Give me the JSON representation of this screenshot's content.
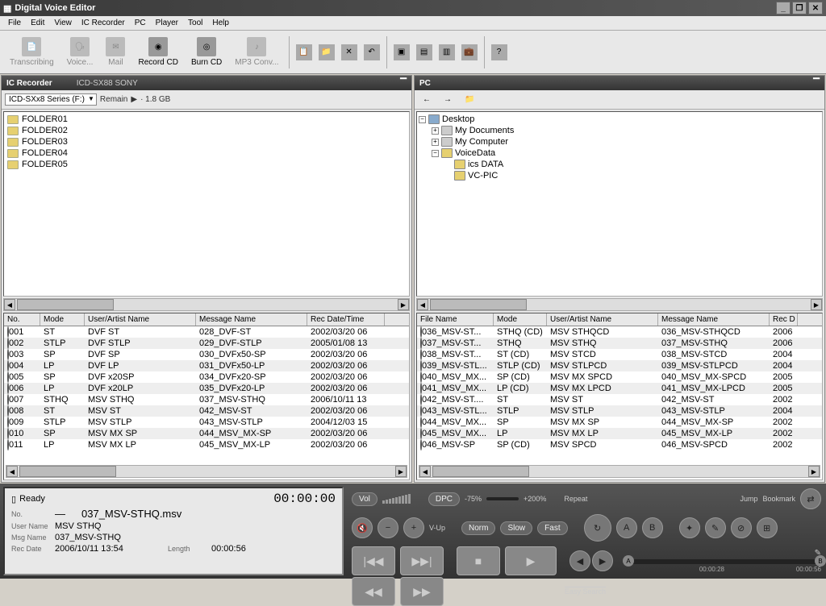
{
  "title": "Digital Voice Editor",
  "menu": [
    "File",
    "Edit",
    "View",
    "IC Recorder",
    "PC",
    "Player",
    "Tool",
    "Help"
  ],
  "toolbar": {
    "transcribing": "Transcribing",
    "voice": "Voice...",
    "mail": "Mail",
    "record_cd": "Record CD",
    "burn_cd": "Burn CD",
    "mp3_conv": "MP3 Conv..."
  },
  "left": {
    "title": "IC Recorder",
    "model": "ICD-SX88 SONY",
    "dropdown": "ICD-SXx8 Series (F:)",
    "remain_label": "Remain",
    "remain_val": "· 1.8 GB",
    "folders": [
      "FOLDER01",
      "FOLDER02",
      "FOLDER03",
      "FOLDER04",
      "FOLDER05"
    ],
    "columns": [
      "No.",
      "Mode",
      "User/Artist Name",
      "Message Name",
      "Rec Date/Time"
    ],
    "rows": [
      {
        "no": "001",
        "mode": "ST",
        "user": "DVF ST",
        "msg": "028_DVF-ST",
        "date": "2002/03/20 06"
      },
      {
        "no": "002",
        "mode": "STLP",
        "user": "DVF STLP",
        "msg": "029_DVF-STLP",
        "date": "2005/01/08 13"
      },
      {
        "no": "003",
        "mode": "SP",
        "user": "DVF SP",
        "msg": "030_DVFx50-SP",
        "date": "2002/03/20 06"
      },
      {
        "no": "004",
        "mode": "LP",
        "user": "DVF LP",
        "msg": "031_DVFx50-LP",
        "date": "2002/03/20 06"
      },
      {
        "no": "005",
        "mode": "SP",
        "user": "DVF x20SP",
        "msg": "034_DVFx20-SP",
        "date": "2002/03/20 06"
      },
      {
        "no": "006",
        "mode": "LP",
        "user": "DVF x20LP",
        "msg": "035_DVFx20-LP",
        "date": "2002/03/20 06"
      },
      {
        "no": "007",
        "mode": "STHQ",
        "user": "MSV STHQ",
        "msg": "037_MSV-STHQ",
        "date": "2006/10/11 13"
      },
      {
        "no": "008",
        "mode": "ST",
        "user": "MSV ST",
        "msg": "042_MSV-ST",
        "date": "2002/03/20 06"
      },
      {
        "no": "009",
        "mode": "STLP",
        "user": "MSV STLP",
        "msg": "043_MSV-STLP",
        "date": "2004/12/03 15"
      },
      {
        "no": "010",
        "mode": "SP",
        "user": "MSV MX SP",
        "msg": "044_MSV_MX-SP",
        "date": "2002/03/20 06"
      },
      {
        "no": "011",
        "mode": "LP",
        "user": "MSV MX LP",
        "msg": "045_MSV_MX-LP",
        "date": "2002/03/20 06"
      }
    ]
  },
  "right": {
    "title": "PC",
    "tree": {
      "root": "Desktop",
      "children": [
        "My Documents",
        "My Computer",
        "VoiceData"
      ],
      "voicedata_children": [
        "ics DATA",
        "VC-PIC"
      ]
    },
    "columns": [
      "File Name",
      "Mode",
      "User/Artist Name",
      "Message Name",
      "Rec D"
    ],
    "rows": [
      {
        "file": "036_MSV-ST...",
        "mode": "STHQ (CD)",
        "user": "MSV STHQCD",
        "msg": "036_MSV-STHQCD",
        "date": "2006"
      },
      {
        "file": "037_MSV-ST...",
        "mode": "STHQ",
        "user": "MSV STHQ",
        "msg": "037_MSV-STHQ",
        "date": "2006"
      },
      {
        "file": "038_MSV-ST...",
        "mode": "ST (CD)",
        "user": "MSV STCD",
        "msg": "038_MSV-STCD",
        "date": "2004"
      },
      {
        "file": "039_MSV-STL...",
        "mode": "STLP (CD)",
        "user": "MSV STLPCD",
        "msg": "039_MSV-STLPCD",
        "date": "2004"
      },
      {
        "file": "040_MSV_MX...",
        "mode": "SP (CD)",
        "user": "MSV MX SPCD",
        "msg": "040_MSV_MX-SPCD",
        "date": "2005"
      },
      {
        "file": "041_MSV_MX...",
        "mode": "LP (CD)",
        "user": "MSV MX LPCD",
        "msg": "041_MSV_MX-LPCD",
        "date": "2005"
      },
      {
        "file": "042_MSV-ST....",
        "mode": "ST",
        "user": "MSV ST",
        "msg": "042_MSV-ST",
        "date": "2002"
      },
      {
        "file": "043_MSV-STL...",
        "mode": "STLP",
        "user": "MSV STLP",
        "msg": "043_MSV-STLP",
        "date": "2004"
      },
      {
        "file": "044_MSV_MX...",
        "mode": "SP",
        "user": "MSV MX SP",
        "msg": "044_MSV_MX-SP",
        "date": "2002"
      },
      {
        "file": "045_MSV_MX...",
        "mode": "LP",
        "user": "MSV MX LP",
        "msg": "045_MSV_MX-LP",
        "date": "2002"
      },
      {
        "file": "046_MSV-SP",
        "mode": "SP (CD)",
        "user": "MSV SPCD",
        "msg": "046_MSV-SPCD",
        "date": "2002"
      }
    ]
  },
  "status": {
    "ready": "Ready",
    "time": "00:00:00",
    "no_label": "No.",
    "no_val": "—",
    "file": "037_MSV-STHQ.msv",
    "user_label": "User Name",
    "user_val": "MSV STHQ",
    "msg_label": "Msg Name",
    "msg_val": "037_MSV-STHQ",
    "rec_label": "Rec Date",
    "rec_val": "2006/10/11 13:54",
    "length_label": "Length",
    "length_val": "00:00:56"
  },
  "controls": {
    "vol": "Vol",
    "vup": "V-Up",
    "dpc": "DPC",
    "dpc_min": "-75%",
    "dpc_max": "+200%",
    "norm": "Norm",
    "slow": "Slow",
    "fast": "Fast",
    "repeat": "Repeat",
    "jump": "Jump",
    "bookmark": "Bookmark",
    "easy": "Easy Search",
    "time_mid": "00:00:28",
    "time_end": "00:00:56",
    "a": "A",
    "b": "B"
  }
}
